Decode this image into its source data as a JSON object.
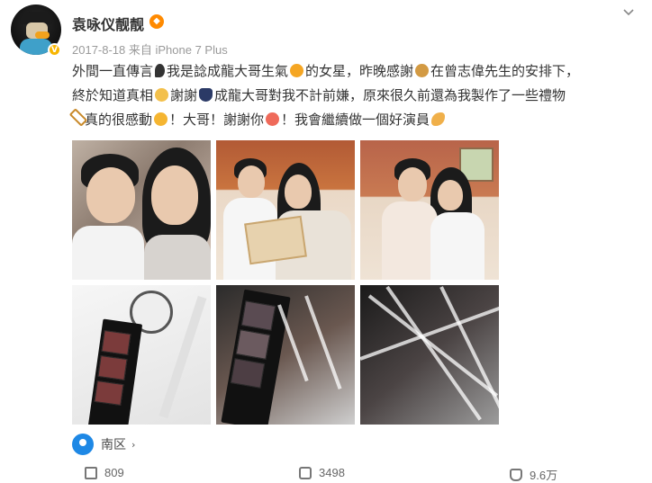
{
  "post": {
    "username": "袁咏仪靓靓",
    "vip_badge": "V",
    "meta": "2017-8-18 来自 iPhone 7 Plus",
    "text_lines": [
      {
        "parts": [
          "外間一直傳言",
          "",
          "我是諗成龍大哥生氣",
          "",
          "的女星，昨晚感謝",
          "",
          "在曾志偉先生的安排下，"
        ]
      },
      {
        "parts": [
          "終於知道真相",
          "",
          "謝謝",
          "",
          "成龍大哥對我不計前嫌，原來很久前還為我製作了一些禮物"
        ]
      },
      {
        "parts": [
          "",
          "真的很感動",
          "",
          "！大哥！謝謝你",
          "",
          "！我會繼續做一個好演員",
          ""
        ]
      }
    ]
  },
  "location": {
    "label": "南区",
    "arrow": "›"
  },
  "actions": {
    "share_count": "809",
    "comment_count": "3498",
    "like_count": "9.6万"
  },
  "colors": {
    "accent_blue": "#1e88e5",
    "vip_orange": "#ff8a00",
    "badge_yellow": "#f7b500"
  },
  "icons": [
    "avatar",
    "verified-badge-icon",
    "vip-icon",
    "chevron-down-icon",
    "location-pin-icon",
    "location-arrow-icon",
    "share-icon",
    "comment-icon",
    "like-icon"
  ]
}
